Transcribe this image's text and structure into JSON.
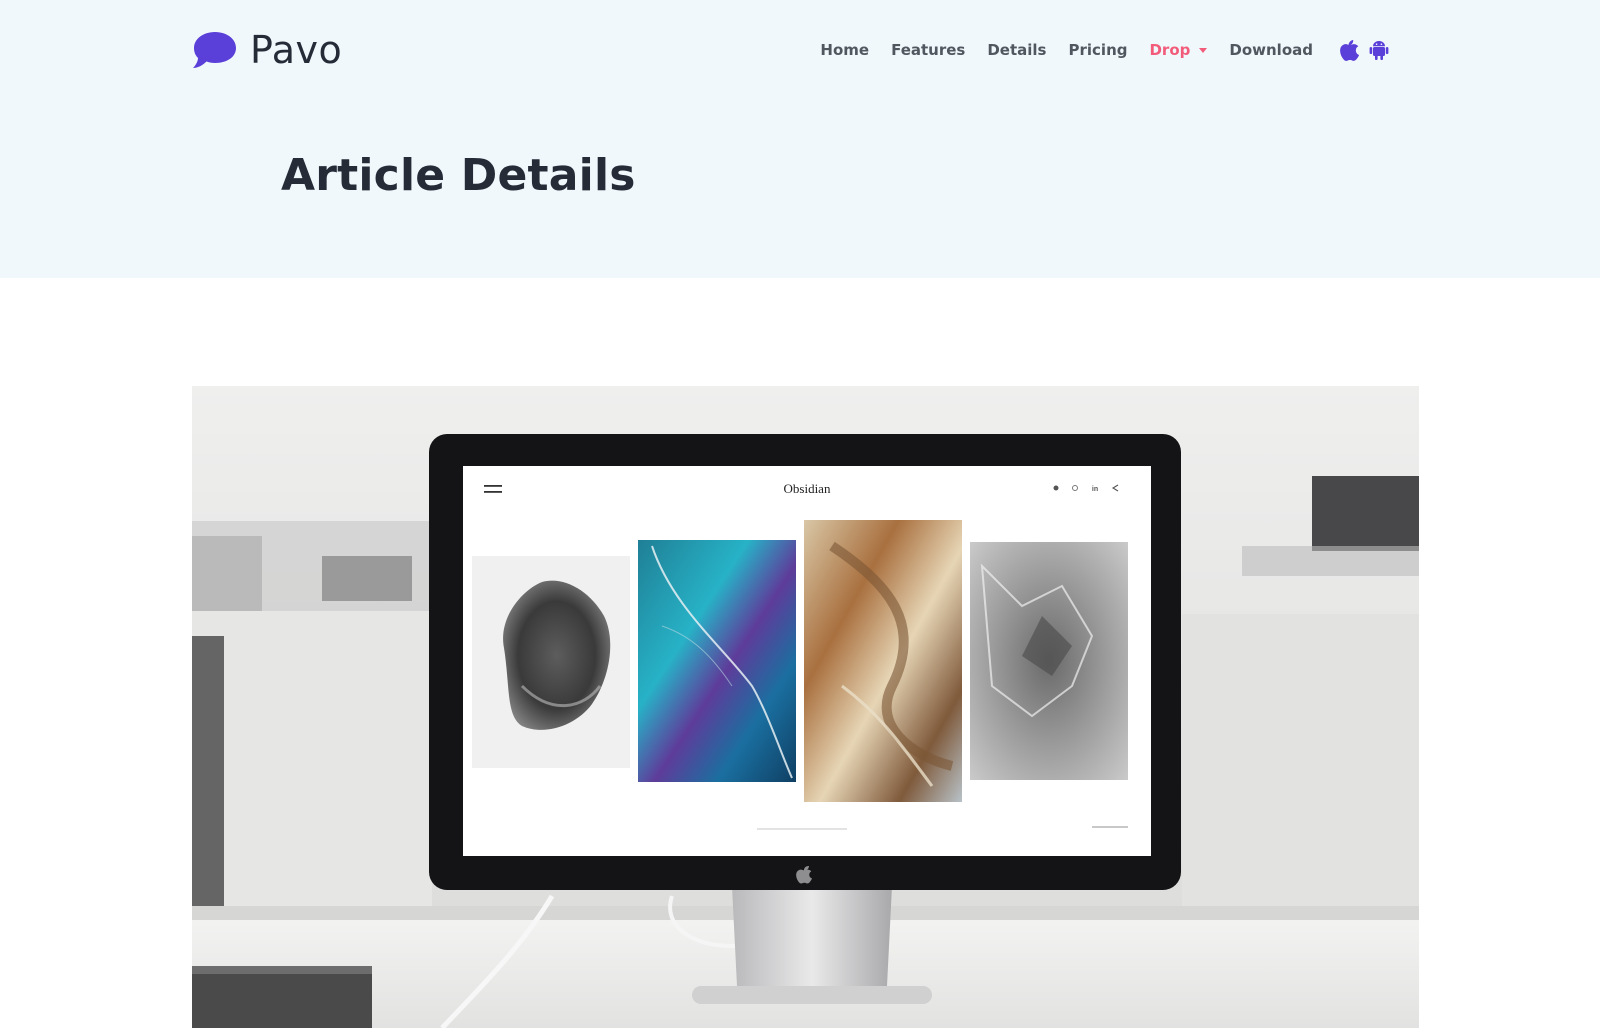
{
  "brand": {
    "name": "Pavo",
    "accent": "#5a3fd8"
  },
  "nav": {
    "items": [
      {
        "label": "Home"
      },
      {
        "label": "Features"
      },
      {
        "label": "Details"
      },
      {
        "label": "Pricing"
      },
      {
        "label": "Drop",
        "active": true,
        "dropdown": true
      },
      {
        "label": "Download"
      }
    ],
    "store_icons": [
      "apple-icon",
      "android-icon"
    ],
    "active_color": "#f25c7a"
  },
  "header": {
    "title": "Article Details",
    "background": "#f1f8fc"
  },
  "hero": {
    "screen_site_title": "Obsidian",
    "screen_social_icons": [
      "twitter-icon",
      "instagram-icon",
      "linkedin-icon",
      "share-icon"
    ]
  }
}
